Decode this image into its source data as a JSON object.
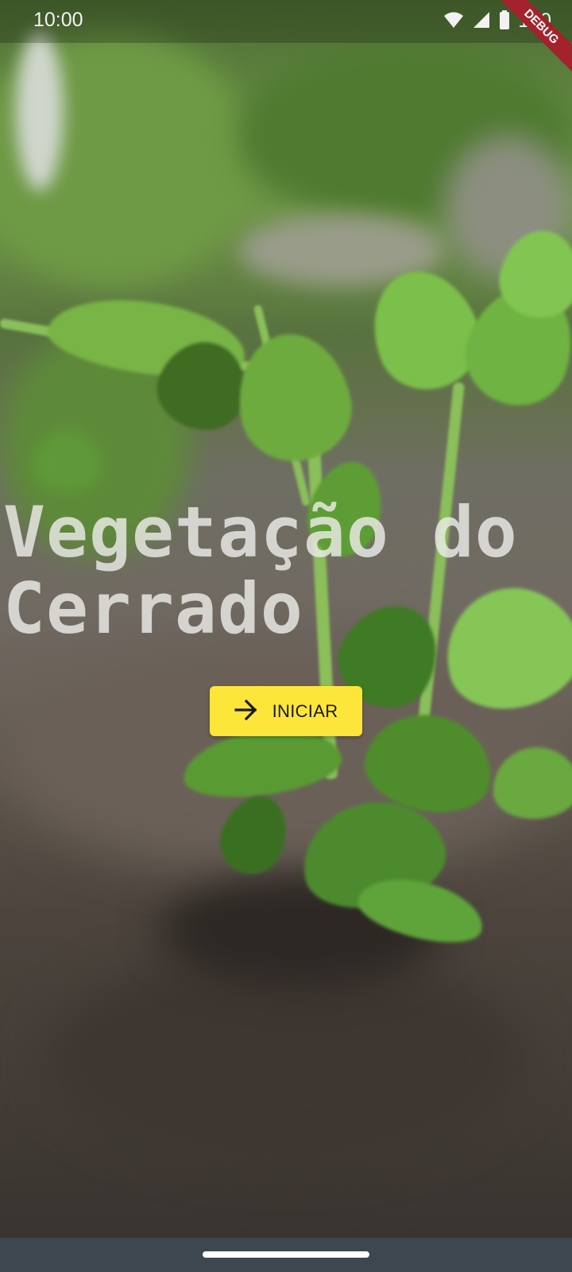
{
  "status_bar": {
    "time": "10:00",
    "battery": "100",
    "icons": [
      "wifi-icon",
      "signal-icon",
      "battery-icon"
    ]
  },
  "debug_banner": "DEBUG",
  "hero": {
    "title": "Vegetação do Cerrado",
    "background_image": "seedling-plant-in-soil-photo"
  },
  "start_button": {
    "label": "INICIAR",
    "icon": "arrow-right-icon",
    "color": "#fde63a"
  },
  "colors": {
    "nav_bar": "#3e4650",
    "debug_banner": "#a3222c"
  }
}
